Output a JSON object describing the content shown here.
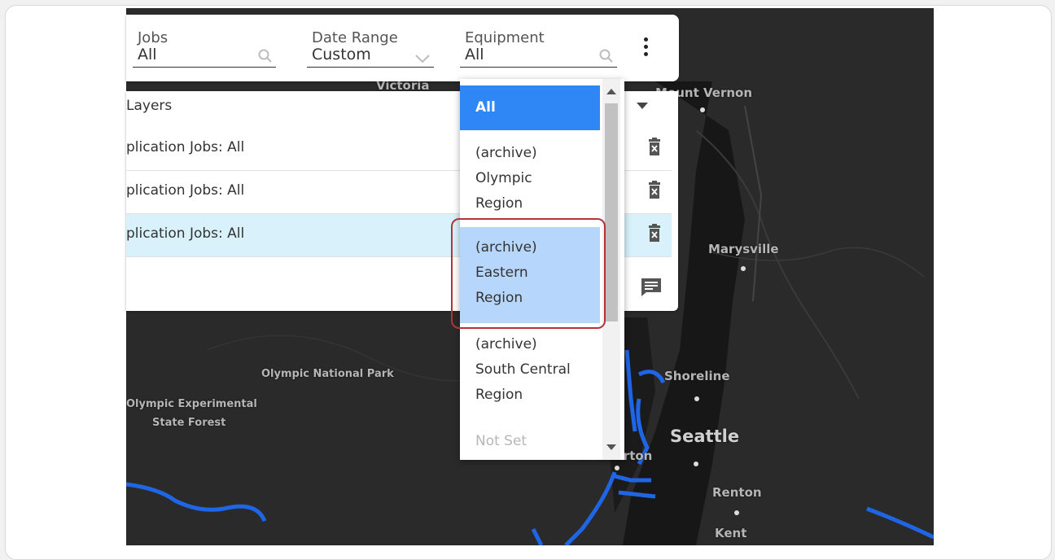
{
  "filters": {
    "jobs": {
      "label": "Jobs",
      "value": "All"
    },
    "date_range": {
      "label": "Date Range",
      "value": "Custom"
    },
    "equipment": {
      "label": "Equipment",
      "value": "All"
    }
  },
  "layers_panel": {
    "title": "Layers",
    "rows": [
      {
        "label": "plication Jobs: All",
        "selected": false
      },
      {
        "label": "plication Jobs: All",
        "selected": false
      },
      {
        "label": "plication Jobs: All",
        "selected": true
      }
    ]
  },
  "equipment_dropdown": {
    "options": [
      {
        "lines": [
          "All"
        ],
        "state": "selected"
      },
      {
        "lines": [
          "(archive)",
          "Olympic",
          "Region"
        ],
        "state": "normal"
      },
      {
        "lines": [
          "(archive)",
          "Eastern",
          "Region"
        ],
        "state": "highlighted"
      },
      {
        "lines": [
          "(archive)",
          "South Central",
          "Region"
        ],
        "state": "normal"
      },
      {
        "lines": [
          "Not Set"
        ],
        "state": "muted"
      }
    ]
  },
  "map_labels": {
    "victoria": "Victoria",
    "mount_vernon": "Mount Vernon",
    "marysville": "Marysville",
    "olympic_np": "Olympic National Park",
    "olympic_exp_1": "Olympic Experimental",
    "olympic_exp_2": "State Forest",
    "shoreline": "Shoreline",
    "seattle": "Seattle",
    "bremerton": "Bremerton",
    "renton": "Renton",
    "kent": "Kent"
  },
  "colors": {
    "accent": "#2f86f5",
    "highlight": "#b6d7fb",
    "selected_row": "#d8f1fb",
    "callout": "#b2343b",
    "map_background": "#2a2a2a",
    "route": "#1f66e6"
  }
}
